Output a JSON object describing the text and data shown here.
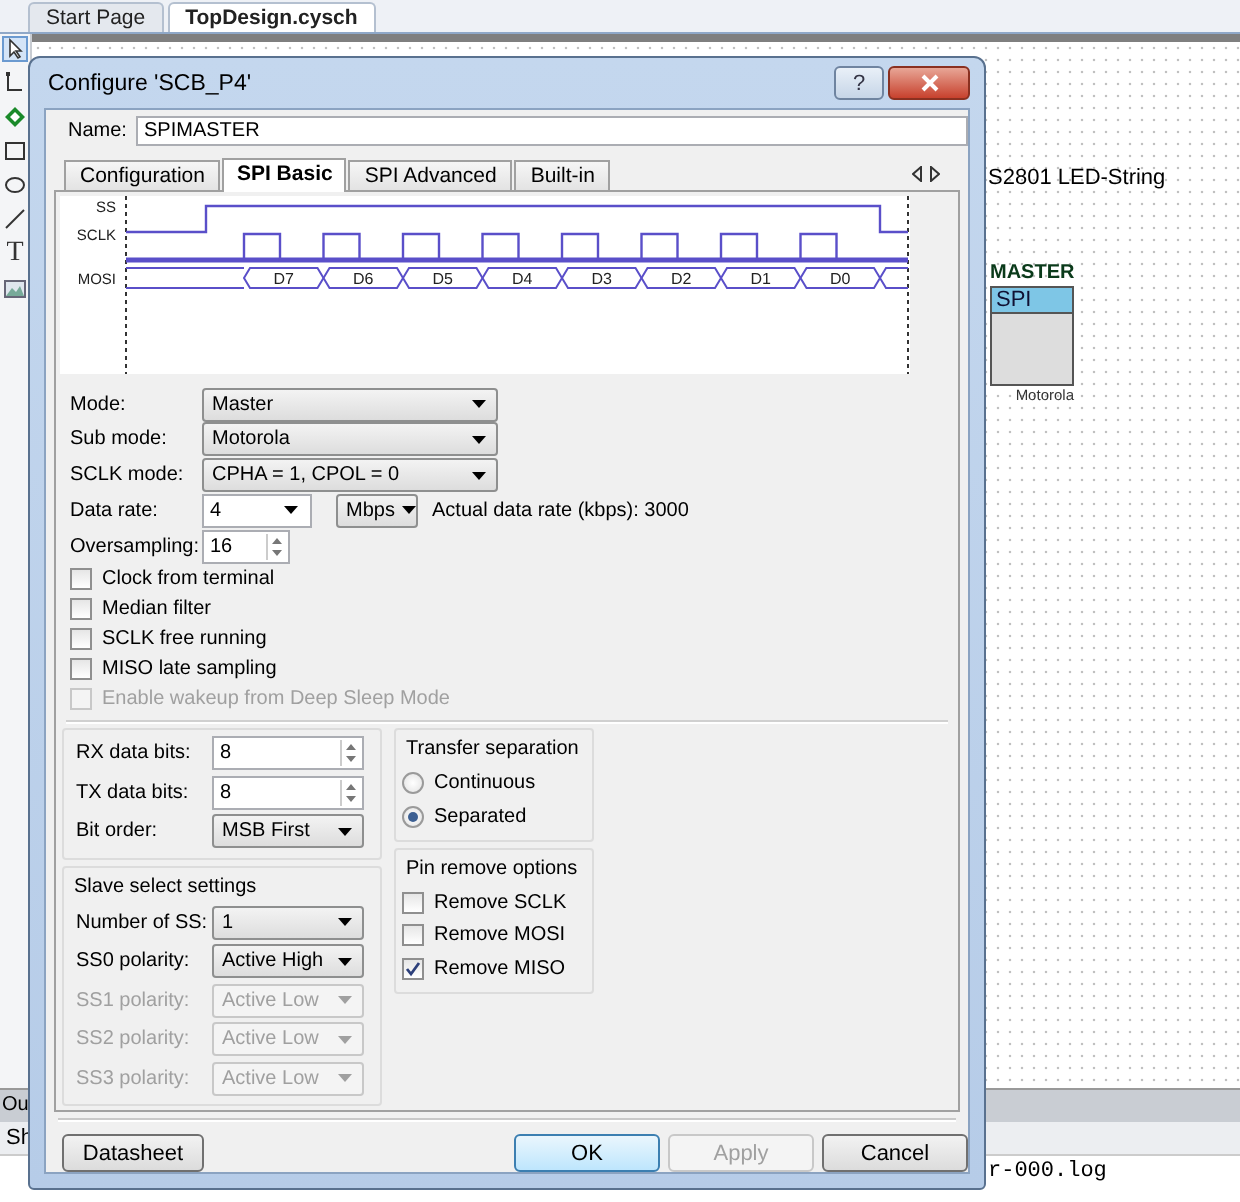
{
  "ide": {
    "tabs": [
      {
        "label": "Start Page",
        "selected": false
      },
      {
        "label": "TopDesign.cysch",
        "selected": true
      }
    ],
    "toolbar": {
      "text_tool": "T"
    },
    "canvas_label": "S2801 LED-String",
    "component": {
      "name": "MASTER",
      "type": "SPI",
      "footer": "Motorola"
    },
    "output_panel": {
      "tab": "Ou",
      "row": "Sh",
      "log_line": "r-000.log"
    }
  },
  "dialog": {
    "title": "Configure 'SCB_P4'",
    "help_button": "?",
    "name_label": "Name:",
    "name_value": "SPIMASTER",
    "tabs": [
      {
        "label": "Configuration",
        "selected": false
      },
      {
        "label": "SPI Basic",
        "selected": true
      },
      {
        "label": "SPI Advanced",
        "selected": false
      },
      {
        "label": "Built-in",
        "selected": false
      }
    ],
    "timing": {
      "signals": [
        "SS",
        "SCLK",
        "MOSI"
      ],
      "bits": [
        "D7",
        "D6",
        "D5",
        "D4",
        "D3",
        "D2",
        "D1",
        "D0"
      ]
    },
    "fields": [
      {
        "kind": "dropdown",
        "label": "Mode:",
        "value": "Master"
      },
      {
        "kind": "dropdown",
        "label": "Sub mode:",
        "value": "Motorola"
      },
      {
        "kind": "dropdown",
        "label": "SCLK mode:",
        "value": "CPHA = 1, CPOL = 0"
      },
      {
        "kind": "rate",
        "label": "Data rate:",
        "value": "4",
        "unit": "Mbps",
        "reading": "Actual data rate (kbps): 3000"
      },
      {
        "kind": "spinner",
        "label": "Oversampling:",
        "value": "16"
      }
    ],
    "options": [
      {
        "label": "Clock from terminal",
        "checked": false,
        "disabled": false
      },
      {
        "label": "Median filter",
        "checked": false,
        "disabled": false
      },
      {
        "label": "SCLK free running",
        "checked": false,
        "disabled": false
      },
      {
        "label": "MISO late sampling",
        "checked": false,
        "disabled": false
      },
      {
        "label": "Enable wakeup from Deep Sleep Mode",
        "checked": false,
        "disabled": true
      }
    ],
    "data_bits": [
      {
        "kind": "spinner",
        "label": "RX data bits:",
        "value": "8"
      },
      {
        "kind": "spinner",
        "label": "TX data bits:",
        "value": "8"
      },
      {
        "kind": "dropdown",
        "label": "Bit order:",
        "value": "MSB First"
      }
    ],
    "slave_select": {
      "title": "Slave select settings",
      "fields": [
        {
          "label": "Number of SS:",
          "value": "1",
          "disabled": false
        },
        {
          "label": "SS0 polarity:",
          "value": "Active High",
          "disabled": false
        },
        {
          "label": "SS1 polarity:",
          "value": "Active Low",
          "disabled": true
        },
        {
          "label": "SS2 polarity:",
          "value": "Active Low",
          "disabled": true
        },
        {
          "label": "SS3 polarity:",
          "value": "Active Low",
          "disabled": true
        }
      ]
    },
    "transfer_separation": {
      "title": "Transfer separation",
      "options": [
        {
          "label": "Continuous",
          "selected": false
        },
        {
          "label": "Separated",
          "selected": true
        }
      ]
    },
    "pin_remove": {
      "title": "Pin remove options",
      "options": [
        {
          "label": "Remove SCLK",
          "checked": false
        },
        {
          "label": "Remove MOSI",
          "checked": false
        },
        {
          "label": "Remove MISO",
          "checked": true
        }
      ]
    },
    "buttons": [
      {
        "label": "Datasheet",
        "default": false,
        "disabled": false
      },
      {
        "label": "OK",
        "default": true,
        "disabled": false
      },
      {
        "label": "Apply",
        "default": false,
        "disabled": true
      },
      {
        "label": "Cancel",
        "default": false,
        "disabled": false
      }
    ]
  }
}
